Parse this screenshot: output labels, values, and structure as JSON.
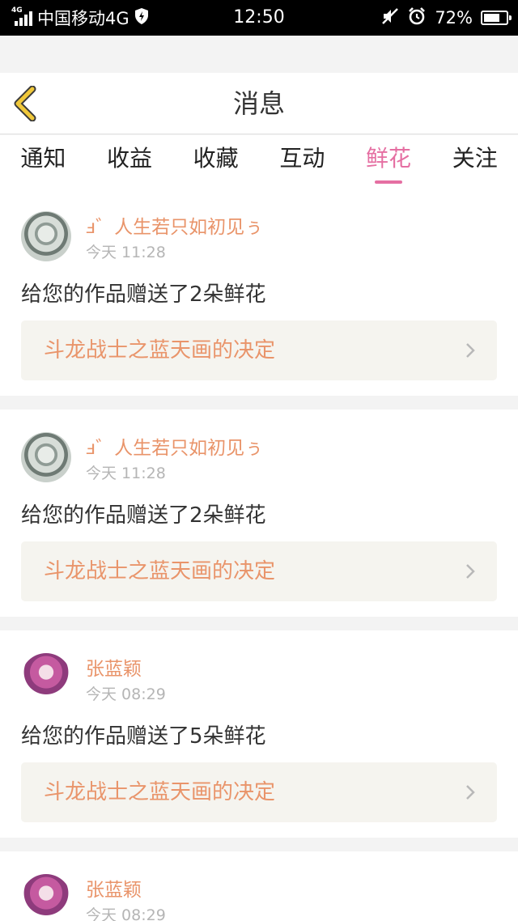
{
  "status_bar": {
    "network_small": "4G",
    "carrier": "中国移动4G",
    "time": "12:50",
    "battery": "72%",
    "battery_level": 0.72
  },
  "header": {
    "title": "消息",
    "back_icon": "chevron-left-icon",
    "accent_color": "#f0c83a"
  },
  "tabs": [
    {
      "label": "通知",
      "active": false
    },
    {
      "label": "收益",
      "active": false
    },
    {
      "label": "收藏",
      "active": false
    },
    {
      "label": "互动",
      "active": false
    },
    {
      "label": "鲜花",
      "active": true
    },
    {
      "label": "关注",
      "active": false
    }
  ],
  "colors": {
    "active_tab": "#e56fa2",
    "name": "#e9946a",
    "work_title": "#e9946a"
  },
  "messages": [
    {
      "name": "ⅎ゛人生若只如初见ぅ",
      "time": "今天 11:28",
      "text": "给您的作品赠送了2朵鲜花",
      "work_title": "斗龙战士之蓝天画的决定"
    },
    {
      "name": "ⅎ゛人生若只如初见ぅ",
      "time": "今天 11:28",
      "text": "给您的作品赠送了2朵鲜花",
      "work_title": "斗龙战士之蓝天画的决定"
    },
    {
      "name": "张蓝颖",
      "time": "今天 08:29",
      "text": "给您的作品赠送了5朵鲜花",
      "work_title": "斗龙战士之蓝天画的决定"
    },
    {
      "name": "张蓝颖",
      "time": "今天 08:29"
    }
  ]
}
